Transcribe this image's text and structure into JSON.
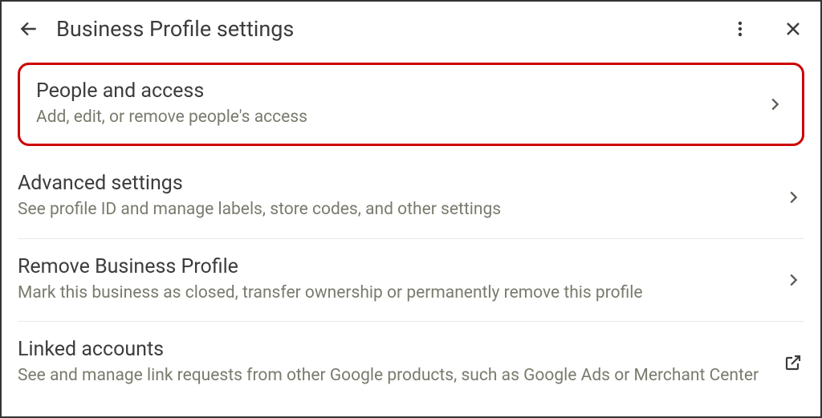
{
  "header": {
    "title": "Business Profile settings"
  },
  "items": [
    {
      "title": "People and access",
      "desc": "Add, edit, or remove people's access"
    },
    {
      "title": "Advanced settings",
      "desc": "See profile ID and manage labels, store codes, and other settings"
    },
    {
      "title": "Remove Business Profile",
      "desc": "Mark this business as closed, transfer ownership or permanently remove this profile"
    },
    {
      "title": "Linked accounts",
      "desc": "See and manage link requests from other Google products, such as Google Ads or Merchant Center"
    }
  ]
}
